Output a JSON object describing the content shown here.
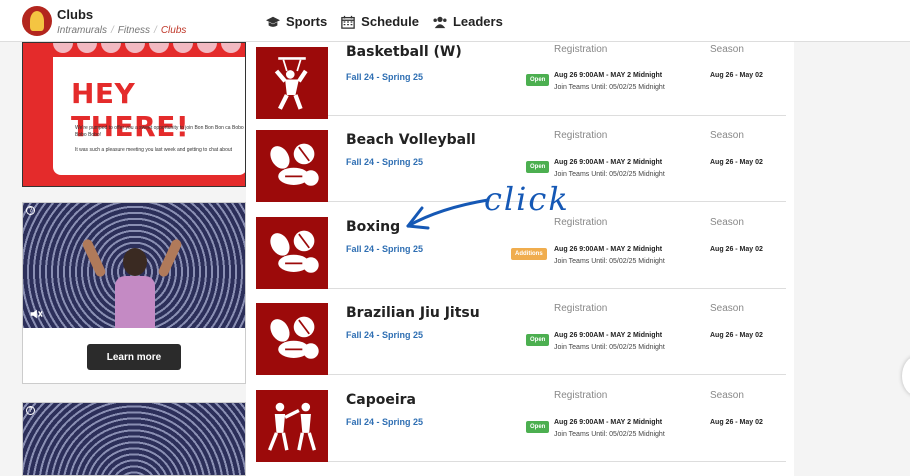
{
  "header": {
    "brand": "Clubs",
    "breadcrumb": [
      "Intramurals",
      "Fitness",
      "Clubs"
    ],
    "nav": [
      {
        "label": "Sports",
        "icon": "graduation-cap-icon"
      },
      {
        "label": "Schedule",
        "icon": "calendar-icon"
      },
      {
        "label": "Leaders",
        "icon": "users-icon"
      }
    ]
  },
  "ads": {
    "ad1": {
      "headline": "HEY THERE!",
      "para1": "We're pumped to offer you a sweet opportunity to join Bon Bon Bon ca Bobo Bobo Bobo!",
      "para2": "It was such a pleasure meeting you last week and getting to chat about"
    },
    "ad2": {
      "cta": "Learn more"
    }
  },
  "sports": [
    {
      "name": "Basketball (W)",
      "term": "Fall 24 - Spring 25",
      "reg_header": "Registration",
      "season_header": "Season",
      "status": "Open",
      "reg_dates": "Aug 26 9:00AM - MAY 2 Midnight",
      "join_until": "Join Teams Until: 05/02/25 Midnight",
      "season": "Aug 26 - May 02"
    },
    {
      "name": "Beach Volleyball",
      "term": "Fall 24 - Spring 25",
      "reg_header": "Registration",
      "season_header": "Season",
      "status": "Open",
      "reg_dates": "Aug 26 9:00AM - MAY 2 Midnight",
      "join_until": "Join Teams Until: 05/02/25 Midnight",
      "season": "Aug 26 - May 02"
    },
    {
      "name": "Boxing",
      "term": "Fall 24 - Spring 25",
      "reg_header": "Registration",
      "season_header": "Season",
      "status": "Additions",
      "reg_dates": "Aug 26 9:00AM - MAY 2 Midnight",
      "join_until": "Join Teams Until: 05/02/25 Midnight",
      "season": "Aug 26 - May 02"
    },
    {
      "name": "Brazilian Jiu Jitsu",
      "term": "Fall 24 - Spring 25",
      "reg_header": "Registration",
      "season_header": "Season",
      "status": "Open",
      "reg_dates": "Aug 26 9:00AM - MAY 2 Midnight",
      "join_until": "Join Teams Until: 05/02/25 Midnight",
      "season": "Aug 26 - May 02"
    },
    {
      "name": "Capoeira",
      "term": "Fall 24 - Spring 25",
      "reg_header": "Registration",
      "season_header": "Season",
      "status": "Open",
      "reg_dates": "Aug 26 9:00AM - MAY 2 Midnight",
      "join_until": "Join Teams Until: 05/02/25 Midnight",
      "season": "Aug 26 - May 02"
    }
  ],
  "annotation": {
    "text": "click"
  },
  "colors": {
    "brand_red": "#9c0a0a",
    "link_blue": "#2f6fb3",
    "open_green": "#4caf50",
    "additions_orange": "#f0ad4e",
    "annotation_blue": "#1558b5"
  }
}
